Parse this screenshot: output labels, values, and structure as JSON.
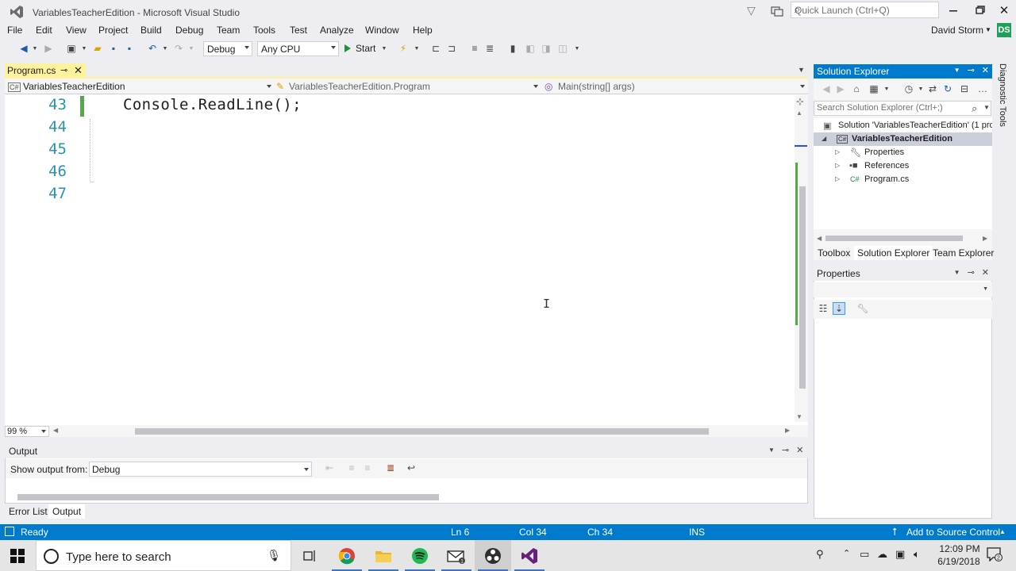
{
  "window": {
    "title": "VariablesTeacherEdition - Microsoft Visual Studio",
    "quick_launch_placeholder": "Quick Launch (Ctrl+Q)",
    "user_name": "David Storm",
    "user_initials": "DS"
  },
  "menu": [
    "File",
    "Edit",
    "View",
    "Project",
    "Build",
    "Debug",
    "Team",
    "Tools",
    "Test",
    "Analyze",
    "Window",
    "Help"
  ],
  "toolbar": {
    "configuration": "Debug",
    "platform": "Any CPU",
    "start_label": "Start"
  },
  "document_tab": {
    "label": "Program.cs"
  },
  "navigation": {
    "project": "VariablesTeacherEdition",
    "class": "VariablesTeacherEdition.Program",
    "member": "Main(string[] args)"
  },
  "editor": {
    "lines": [
      "43",
      "44",
      "45",
      "46",
      "47"
    ],
    "code": "Console.ReadLine();",
    "zoom": "99 %",
    "cursor_glyph": "I"
  },
  "output_panel": {
    "title": "Output",
    "show_output_from_label": "Show output from:",
    "source": "Debug"
  },
  "bottom_tabs": [
    "Error List",
    "Output"
  ],
  "solution_explorer": {
    "title": "Solution Explorer",
    "search_placeholder": "Search Solution Explorer (Ctrl+;)",
    "tree": [
      {
        "label": "Solution 'VariablesTeacherEdition' (1 pro",
        "icon": "solution-icon"
      },
      {
        "label": "VariablesTeacherEdition",
        "icon": "csharp-project-icon"
      },
      {
        "label": "Properties",
        "icon": "wrench-icon"
      },
      {
        "label": "References",
        "icon": "references-icon"
      },
      {
        "label": "Program.cs",
        "icon": "csharp-file-icon"
      }
    ],
    "tabs": [
      "Toolbox",
      "Solution Explorer",
      "Team Explorer"
    ]
  },
  "properties_panel": {
    "title": "Properties"
  },
  "side_tab": {
    "label": "Diagnostic Tools"
  },
  "status_bar": {
    "state": "Ready",
    "line": "Ln 6",
    "column": "Col 34",
    "character": "Ch 34",
    "mode": "INS",
    "source_control": "Add to Source Control"
  },
  "taskbar": {
    "search_placeholder": "Type here to search",
    "time": "12:09 PM",
    "date": "6/19/2018",
    "apps": [
      "task-view-icon",
      "chrome-icon",
      "file-explorer-icon",
      "spotify-icon",
      "mail-icon",
      "obs-icon",
      "visual-studio-icon"
    ]
  },
  "colors": {
    "accent": "#007ACC",
    "tab_active": "#FFF29D",
    "line_number": "#2B91AF",
    "change_bar": "#57A64A"
  }
}
